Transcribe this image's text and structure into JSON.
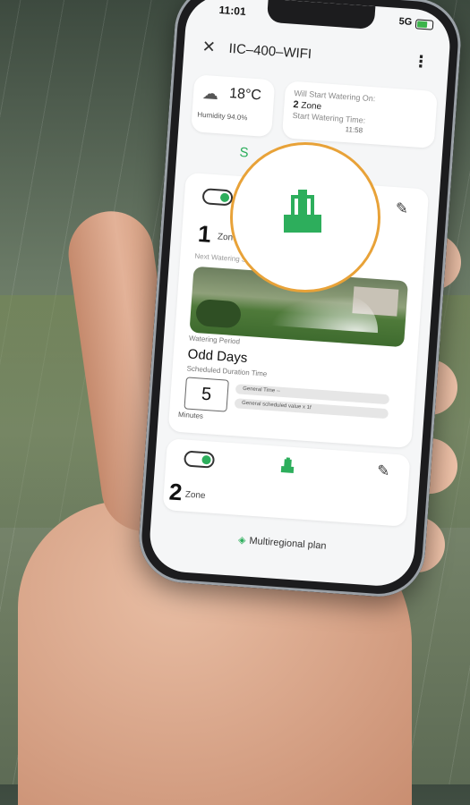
{
  "status_bar": {
    "time": "11:01",
    "network": "5G"
  },
  "header": {
    "close_icon": "close-icon",
    "device_name": "IIC–400–WIFI",
    "menu_icon": "kebab-menu-icon"
  },
  "weather": {
    "icon": "rain-cloud-icon",
    "temperature": "18°C",
    "humidity": "Humidity  94.0%"
  },
  "schedule": {
    "will_start_label": "Will Start Watering On:",
    "zone_number": "2",
    "zone_word": "Zone",
    "start_time_label": "Start Watering Time:",
    "start_time_value": "11:58"
  },
  "partial_letter": "S",
  "zone1": {
    "number": "1",
    "label": "Zone",
    "next_watering_label": "Next Watering Start Time",
    "watering_period_label": "Watering Period",
    "watering_period_value": "Odd Days",
    "duration_label": "Scheduled Duration Time",
    "duration_value": "5",
    "duration_unit": "Minutes",
    "bar1_text": "General Time --",
    "bar2_text": "General scheduled value x 1f"
  },
  "zone2": {
    "number": "2",
    "label": "Zone"
  },
  "plan_button": {
    "label": "Multiregional plan",
    "icon": "layers-icon"
  },
  "colors": {
    "accent_green": "#2dae5c",
    "highlight_orange": "#e8a238"
  }
}
